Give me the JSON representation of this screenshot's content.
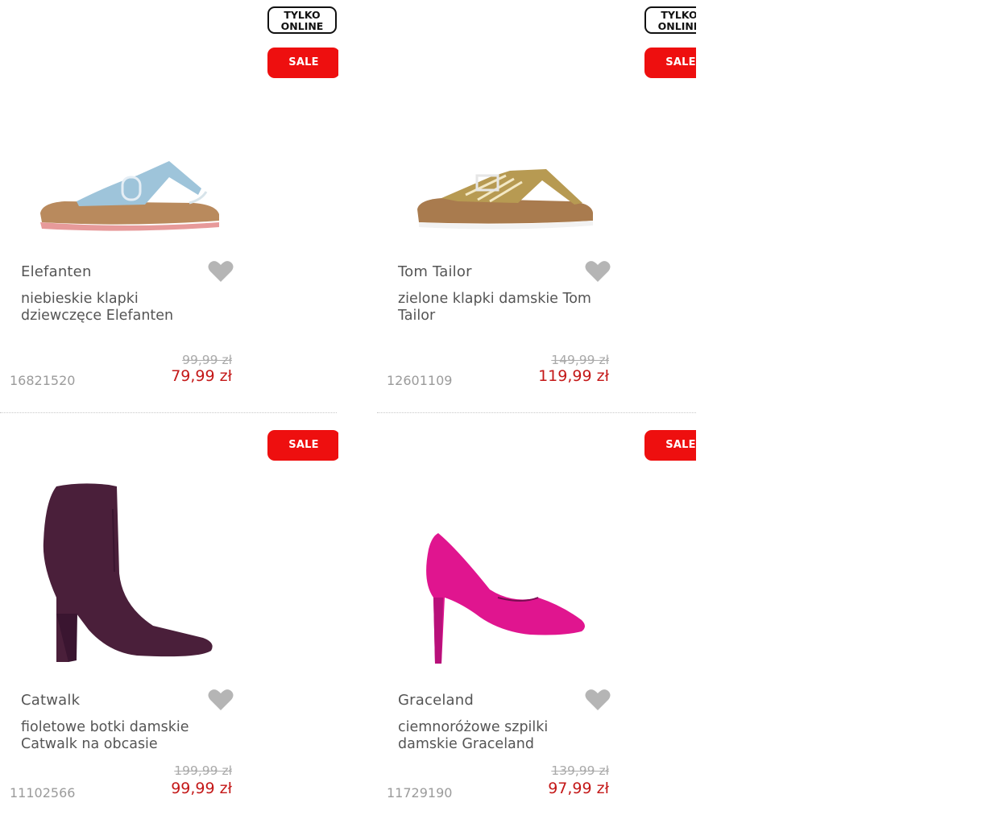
{
  "products": [
    {
      "badge_online": [
        "TYLKO",
        "ONLINE"
      ],
      "badge_sale": "SALE",
      "brand": "Elefanten",
      "title": "niebieskie klapki dziewczęce Elefanten",
      "old_price": "99,99 zł",
      "price": "79,99 zł",
      "sku": "16821520",
      "image_icon": "blue-sandal-image"
    },
    {
      "badge_online": [
        "TYLKO",
        "ONLINE"
      ],
      "badge_sale": "SALE",
      "brand": "Tom Tailor",
      "title": "zielone klapki damskie Tom Tailor",
      "old_price": "149,99 zł",
      "price": "119,99 zł",
      "sku": "12601109",
      "image_icon": "gold-sandal-image"
    },
    {
      "badge_sale": "SALE",
      "brand": "Catwalk",
      "title": "fioletowe botki damskie Catwalk na obcasie",
      "old_price": "199,99 zł",
      "price": "99,99 zł",
      "sku": "11102566",
      "image_icon": "purple-boot-image"
    },
    {
      "badge_sale": "SALE",
      "brand": "Graceland",
      "title": "ciemnoróżowe szpilki damskie Graceland",
      "old_price": "139,99 zł",
      "price": "97,99 zł",
      "sku": "11729190",
      "image_icon": "pink-pump-image"
    }
  ],
  "colors": {
    "sale_badge": "#ee0f0f",
    "price": "#c41818",
    "heart": "#b5b5b5"
  }
}
